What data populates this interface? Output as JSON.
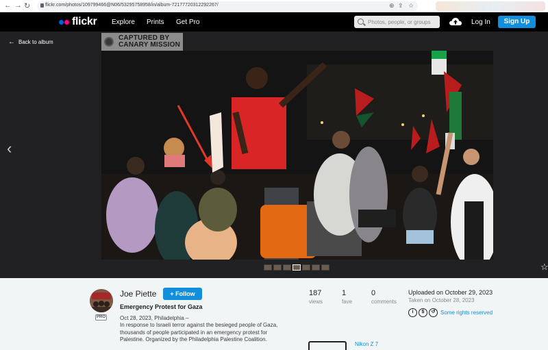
{
  "browser": {
    "url": "flickr.com/photos/109799466@N06/53295758958/in/album-72177720312292267/"
  },
  "header": {
    "logo": "flickr",
    "nav": [
      "Explore",
      "Prints",
      "Get Pro"
    ],
    "search_placeholder": "Photos, people, or groups",
    "login": "Log In",
    "signup": "Sign Up"
  },
  "viewer": {
    "back_label": "Back to album",
    "watermark_line1": "CAPTURED BY",
    "watermark_line2": "CANARY MISSION",
    "thumbnail_count": 7,
    "active_thumbnail": 3
  },
  "photo_info": {
    "author": "Joe Piette",
    "badge": "PRO",
    "follow_label": "+ Follow",
    "title": "Emergency Protest for Gaza",
    "date_location": "Oct 28, 2023, Philadelphia –",
    "description": "In response to Israeli terror against the besieged people of Gaza, thousands of people participated in an emergency protest for Palestine. Organized by the Philadelphia Palestine Coalition."
  },
  "stats": [
    {
      "value": "187",
      "label": "views"
    },
    {
      "value": "1",
      "label": "fave"
    },
    {
      "value": "0",
      "label": "comments"
    }
  ],
  "meta": {
    "uploaded": "Uploaded on October 29, 2023",
    "taken": "Taken on October 28, 2023",
    "rights": "Some rights reserved",
    "camera": "Nikon Z 7"
  },
  "colors": {
    "accent": "#128fdc",
    "logo_blue": "#0063dc",
    "logo_pink": "#ff0084"
  }
}
